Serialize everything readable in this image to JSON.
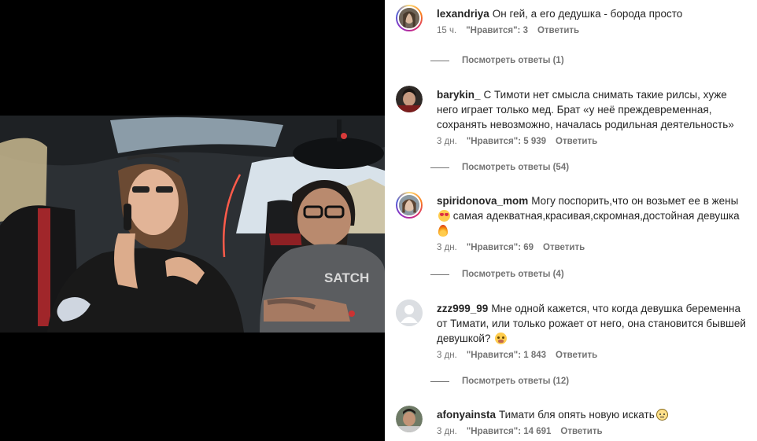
{
  "video": {
    "shirt_print": "SATCH"
  },
  "comments": [
    {
      "username": "lexandriya",
      "text": "Он гей, а его дедушка - борода просто",
      "emoji": [],
      "time": "15 ч.",
      "likes": "\"Нравится\": 3",
      "reply": "Ответить",
      "view_replies": "Посмотреть ответы (1)",
      "avatar": "story-ring"
    },
    {
      "username": "barykin_",
      "text": "С Тимоти нет смысла снимать такие рилсы, хуже него играет только мед. Брат «у неё преждевременная, сохранять невозможно, началась родильная деятельность»",
      "emoji": [],
      "time": "3 дн.",
      "likes": "\"Нравится\": 5 939",
      "reply": "Ответить",
      "view_replies": "Посмотреть ответы (54)",
      "avatar": "plain"
    },
    {
      "username": "spiridonova_mom",
      "text_part1": "Могу поспорить,что он возьмет ее в жены",
      "text_part2": " самая адекватная,красивая,скромная,достойная девушка ",
      "emoji": [
        "heart-eyes-icon",
        "fire-icon"
      ],
      "time": "3 дн.",
      "likes": "\"Нравится\": 69",
      "reply": "Ответить",
      "view_replies": "Посмотреть ответы (4)",
      "avatar": "story-ring"
    },
    {
      "username": "zzz999_99",
      "text": "Мне одной кажется, что когда девушка беременна от Тимати, или только рожает от него, она становится бывшей девушкой? ",
      "emoji": [
        "thinking-face-icon"
      ],
      "time": "3 дн.",
      "likes": "\"Нравится\": 1 843",
      "reply": "Ответить",
      "view_replies": "Посмотреть ответы (12)",
      "avatar": "default-user"
    },
    {
      "username": "afonyainsta",
      "text": "Тимати бля опять новую искать",
      "emoji": [
        "worried-face-icon"
      ],
      "time": "3 дн.",
      "likes": "\"Нравится\": 14 691",
      "reply": "Ответить",
      "avatar": "plain"
    }
  ],
  "colors": {
    "text": "#262626",
    "secondary": "#737373",
    "story_ring": [
      "#feda75",
      "#fa7e1e",
      "#d62976",
      "#962fbf",
      "#4f5bd5"
    ]
  }
}
